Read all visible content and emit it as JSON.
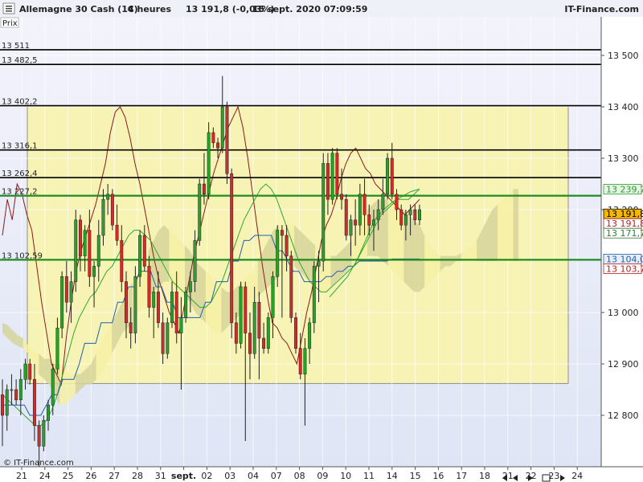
{
  "header": {
    "instrument": "Allemagne 30 Cash (1€)",
    "timeframe": "4 heures",
    "quote": "13 191,8 (-0,03%)",
    "datetime": "15 sept. 2020 07:09:59",
    "brand": "IT-Finance.com"
  },
  "footer": {
    "copyright": "© IT-Finance.com"
  },
  "prix_label": "Prix",
  "chart_data": {
    "type": "line",
    "title": "",
    "ylim": [
      12700,
      13575
    ],
    "y_ticks": [
      {
        "value": 12800,
        "label": "12 800"
      },
      {
        "value": 12900,
        "label": "12 900"
      },
      {
        "value": 13000,
        "label": "13 000"
      },
      {
        "value": 13200,
        "label": "13 200"
      },
      {
        "value": 13300,
        "label": "13 300"
      },
      {
        "value": 13400,
        "label": "13 400"
      },
      {
        "value": 13500,
        "label": "13 500"
      }
    ],
    "x_ticks": [
      "21",
      "24",
      "25",
      "26",
      "27",
      "28",
      "31",
      "sept.",
      "02",
      "03",
      "04",
      "07",
      "08",
      "09",
      "10",
      "11",
      "14",
      "15",
      "16",
      "17",
      "18",
      "21",
      "22",
      "23",
      "24"
    ],
    "levels": [
      {
        "value": 13511,
        "label": "13 511",
        "color": "#000000"
      },
      {
        "value": 13482.5,
        "label": "13 482,5",
        "color": "#000000"
      },
      {
        "value": 13402.2,
        "label": "13 402,2",
        "color": "#000000"
      },
      {
        "value": 13316.1,
        "label": "13 316,1",
        "color": "#000000"
      },
      {
        "value": 13262.4,
        "label": "13 262,4",
        "color": "#000000"
      },
      {
        "value": 13227.2,
        "label": "13 227,2",
        "color": "#1e8c1e"
      },
      {
        "value": 13102.59,
        "label": "13 102,59",
        "color": "#1e8c1e"
      }
    ],
    "value_tags": [
      {
        "value": 13239.7,
        "label": "13 239,7",
        "color": "#2e9a2e",
        "fill": "#e6f5e6"
      },
      {
        "value": 13191.8,
        "label": "13 191,8",
        "color": "#000000",
        "fill": "#f5b800"
      },
      {
        "value": 13191.8,
        "label": "13 191,8",
        "color": "#b22222",
        "fill": "#ffffff"
      },
      {
        "value": 13171.7,
        "label": "13 171,7",
        "color": "#2e7d32",
        "fill": "#ffffff"
      },
      {
        "value": 13104.0,
        "label": "13 104,0",
        "color": "#1f5fb0",
        "fill": "#e6eefa"
      },
      {
        "value": 13103.7,
        "label": "13 103,7",
        "color": "#b22222",
        "fill": "#ffffff"
      }
    ],
    "zone": {
      "top": 13402.2,
      "bottom": 12862
    },
    "candles": [
      [
        12840,
        12870,
        12740,
        12800
      ],
      [
        12800,
        12860,
        12770,
        12850
      ],
      [
        12850,
        12880,
        12820,
        12850
      ],
      [
        12850,
        12870,
        12820,
        12830
      ],
      [
        12830,
        12890,
        12800,
        12870
      ],
      [
        12870,
        12910,
        12850,
        12900
      ],
      [
        12900,
        12910,
        12860,
        12870
      ],
      [
        12870,
        12900,
        12750,
        12780
      ],
      [
        12780,
        12790,
        12700,
        12740
      ],
      [
        12740,
        12800,
        12730,
        12790
      ],
      [
        12790,
        12830,
        12770,
        12820
      ],
      [
        12820,
        12900,
        12800,
        12890
      ],
      [
        12890,
        12990,
        12880,
        12970
      ],
      [
        12970,
        13080,
        12950,
        13070
      ],
      [
        13070,
        13100,
        13000,
        13020
      ],
      [
        13020,
        13080,
        12980,
        13060
      ],
      [
        13060,
        13200,
        13040,
        13180
      ],
      [
        13180,
        13190,
        13080,
        13110
      ],
      [
        13110,
        13170,
        13080,
        13160
      ],
      [
        13160,
        13200,
        13050,
        13070
      ],
      [
        13070,
        13100,
        13010,
        13090
      ],
      [
        13090,
        13180,
        13060,
        13150
      ],
      [
        13150,
        13240,
        13130,
        13220
      ],
      [
        13220,
        13250,
        13190,
        13230
      ],
      [
        13230,
        13240,
        13160,
        13170
      ],
      [
        13170,
        13210,
        13130,
        13140
      ],
      [
        13140,
        13170,
        13040,
        13060
      ],
      [
        13060,
        13080,
        12950,
        12980
      ],
      [
        12980,
        13010,
        12930,
        12960
      ],
      [
        12960,
        13090,
        12940,
        13070
      ],
      [
        13070,
        13160,
        13050,
        13150
      ],
      [
        13150,
        13170,
        13080,
        13090
      ],
      [
        13090,
        13110,
        12990,
        13010
      ],
      [
        13010,
        13050,
        12950,
        13040
      ],
      [
        13040,
        13080,
        12970,
        12980
      ],
      [
        12980,
        13000,
        12900,
        12920
      ],
      [
        12920,
        12990,
        12910,
        12980
      ],
      [
        12980,
        13060,
        12970,
        13040
      ],
      [
        13040,
        13080,
        12940,
        12960
      ],
      [
        12960,
        13030,
        12850,
        12990
      ],
      [
        12990,
        13050,
        12980,
        13040
      ],
      [
        13040,
        13080,
        13000,
        13060
      ],
      [
        13060,
        13160,
        13040,
        13140
      ],
      [
        13140,
        13260,
        13130,
        13250
      ],
      [
        13250,
        13310,
        13210,
        13230
      ],
      [
        13230,
        13370,
        13220,
        13350
      ],
      [
        13350,
        13360,
        13320,
        13330
      ],
      [
        13330,
        13340,
        13300,
        13320
      ],
      [
        13320,
        13460,
        13310,
        13400
      ],
      [
        13400,
        13410,
        13250,
        13270
      ],
      [
        13270,
        13280,
        12950,
        12980
      ],
      [
        12980,
        13000,
        12920,
        12940
      ],
      [
        12940,
        13060,
        12930,
        13050
      ],
      [
        13050,
        13060,
        12750,
        12960
      ],
      [
        12960,
        13000,
        12870,
        12920
      ],
      [
        12920,
        13050,
        12910,
        13020
      ],
      [
        13020,
        13040,
        12870,
        12950
      ],
      [
        12950,
        12980,
        12920,
        12930
      ],
      [
        12930,
        13000,
        12920,
        12990
      ],
      [
        12990,
        13080,
        12950,
        13070
      ],
      [
        13070,
        13170,
        13050,
        13160
      ],
      [
        13160,
        13170,
        12990,
        13150
      ],
      [
        13150,
        13170,
        13080,
        13110
      ],
      [
        13110,
        13120,
        12980,
        12990
      ],
      [
        12990,
        13000,
        12920,
        12930
      ],
      [
        12930,
        12960,
        12870,
        12880
      ],
      [
        12880,
        12950,
        12780,
        12930
      ],
      [
        12930,
        12990,
        12900,
        12980
      ],
      [
        12980,
        13100,
        12960,
        13090
      ],
      [
        13090,
        13120,
        13020,
        13100
      ],
      [
        13100,
        13310,
        13080,
        13290
      ],
      [
        13290,
        13310,
        13190,
        13220
      ],
      [
        13220,
        13320,
        13210,
        13310
      ],
      [
        13310,
        13320,
        13220,
        13230
      ],
      [
        13230,
        13280,
        13200,
        13220
      ],
      [
        13220,
        13230,
        13140,
        13150
      ],
      [
        13150,
        13190,
        13110,
        13180
      ],
      [
        13180,
        13220,
        13130,
        13170
      ],
      [
        13170,
        13250,
        13150,
        13230
      ],
      [
        13230,
        13260,
        13150,
        13190
      ],
      [
        13190,
        13210,
        13150,
        13170
      ],
      [
        13170,
        13200,
        13120,
        13180
      ],
      [
        13180,
        13220,
        13160,
        13200
      ],
      [
        13200,
        13260,
        13190,
        13230
      ],
      [
        13230,
        13310,
        13220,
        13300
      ],
      [
        13300,
        13330,
        13220,
        13230
      ],
      [
        13230,
        13240,
        13180,
        13200
      ],
      [
        13200,
        13210,
        13160,
        13170
      ],
      [
        13170,
        13200,
        13140,
        13190
      ],
      [
        13190,
        13210,
        13150,
        13200
      ],
      [
        13200,
        13210,
        13170,
        13180
      ],
      [
        13180,
        13210,
        13170,
        13200
      ]
    ],
    "overlays": [
      {
        "name": "",
        "color": "#8b1a1a",
        "width": 1,
        "values": [
          13150,
          13220,
          13180,
          13250,
          13230,
          13190,
          13160,
          13090,
          13020,
          12960,
          12900,
          12880,
          12860,
          12950,
          13020,
          13080,
          13120,
          13150,
          13180,
          13210,
          13250,
          13290,
          13350,
          13390,
          13400,
          13380,
          13340,
          13290,
          13250,
          13200,
          13150,
          13100,
          13060,
          13030,
          13000,
          12980,
          12960,
          13010,
          13060,
          13110,
          13150,
          13190,
          13230,
          13270,
          13300,
          13330,
          13360,
          13380,
          13400,
          13360,
          13300,
          13230,
          13160,
          13090,
          13030,
          12980,
          12970,
          12950,
          12940,
          12920,
          12900,
          12950,
          13000,
          13040,
          13090,
          13140,
          13170,
          13190,
          13220,
          13260,
          13290,
          13310,
          13320,
          13300,
          13280,
          13270,
          13250,
          13240,
          13230,
          13220,
          13210,
          13200,
          13190,
          13200,
          13210,
          13220
        ]
      },
      {
        "name": "",
        "color": "#2eaa2e",
        "width": 1,
        "values": [
          12840,
          12830,
          12820,
          12810,
          12800,
          12790,
          12780,
          12780,
          12790,
          12810,
          12840,
          12880,
          12920,
          12960,
          12990,
          13010,
          13030,
          13040,
          13060,
          13080,
          13090,
          13110,
          13130,
          13150,
          13160,
          13160,
          13150,
          13140,
          13120,
          13100,
          13080,
          13060,
          13050,
          13040,
          13030,
          13020,
          13010,
          13010,
          13020,
          13040,
          13060,
          13090,
          13120,
          13150,
          13180,
          13200,
          13220,
          13240,
          13250,
          13240,
          13220,
          13190,
          13160,
          13130,
          13100,
          13080,
          13060,
          13050,
          13040,
          13040,
          13050,
          13060,
          13070,
          13080,
          13090,
          13110,
          13130,
          13150,
          13170,
          13190,
          13200,
          13210,
          13220,
          13220,
          13220,
          13230,
          13240
        ]
      },
      {
        "name": "",
        "color": "#1f5fb0",
        "width": 1,
        "values": [
          12820,
          12820,
          12820,
          12820,
          12820,
          12800,
          12800,
          12800,
          12820,
          12840,
          12840,
          12870,
          12870,
          12870,
          12900,
          12940,
          12940,
          12940,
          12980,
          12980,
          12980,
          13020,
          13020,
          13050,
          13050,
          13080,
          13080,
          13080,
          13050,
          13050,
          13020,
          13020,
          12990,
          12990,
          12990,
          12990,
          12990,
          13020,
          13020,
          13060,
          13060,
          13060,
          13100,
          13100,
          13140,
          13140,
          13150,
          13150,
          13150,
          13150,
          13120,
          13120,
          13100,
          13080,
          13080,
          13060,
          13060,
          13060,
          13060,
          13070,
          13070,
          13080,
          13080,
          13090,
          13090,
          13100,
          13100,
          13100,
          13100,
          13100,
          13100,
          13104,
          13104,
          13104,
          13104,
          13104,
          13104
        ]
      }
    ],
    "cloud": [
      [
        12960,
        12980
      ],
      [
        12950,
        12975
      ],
      [
        12940,
        12965
      ],
      [
        12935,
        12955
      ],
      [
        12930,
        12950
      ],
      [
        12920,
        12935
      ],
      [
        12900,
        12925
      ],
      [
        12880,
        12920
      ],
      [
        12870,
        12910
      ],
      [
        12860,
        12910
      ],
      [
        12840,
        12900
      ],
      [
        12820,
        12900
      ],
      [
        12820,
        12890
      ],
      [
        12830,
        12880
      ],
      [
        12840,
        12880
      ],
      [
        12850,
        12880
      ],
      [
        12860,
        12890
      ],
      [
        12860,
        12900
      ],
      [
        12870,
        12920
      ],
      [
        12880,
        12940
      ],
      [
        12900,
        12960
      ],
      [
        12920,
        12980
      ],
      [
        12940,
        13000
      ],
      [
        12960,
        13020
      ],
      [
        12970,
        13040
      ],
      [
        12980,
        13060
      ],
      [
        13000,
        13080
      ],
      [
        13010,
        13100
      ],
      [
        13030,
        13120
      ],
      [
        13040,
        13140
      ],
      [
        13050,
        13160
      ],
      [
        13060,
        13170
      ],
      [
        13060,
        13160
      ],
      [
        13050,
        13150
      ],
      [
        13040,
        13140
      ],
      [
        13030,
        13130
      ],
      [
        13020,
        13120
      ],
      [
        13000,
        13100
      ],
      [
        12990,
        13090
      ],
      [
        12980,
        13080
      ],
      [
        12970,
        13070
      ],
      [
        12960,
        13060
      ],
      [
        12960,
        13050
      ],
      [
        12970,
        13040
      ],
      [
        12980,
        13040
      ],
      [
        12990,
        13050
      ],
      [
        13000,
        13060
      ],
      [
        13010,
        13070
      ],
      [
        13020,
        13080
      ],
      [
        13030,
        13100
      ],
      [
        13040,
        13120
      ],
      [
        13050,
        13140
      ],
      [
        13060,
        13160
      ],
      [
        13070,
        13170
      ],
      [
        13080,
        13170
      ],
      [
        13090,
        13170
      ],
      [
        13090,
        13170
      ],
      [
        13080,
        13160
      ],
      [
        13070,
        13150
      ],
      [
        13060,
        13140
      ],
      [
        13050,
        13130
      ],
      [
        13040,
        13120
      ],
      [
        13040,
        13110
      ],
      [
        13050,
        13110
      ],
      [
        13060,
        13110
      ],
      [
        13070,
        13120
      ],
      [
        13080,
        13130
      ],
      [
        13090,
        13140
      ],
      [
        13090,
        13160
      ],
      [
        13100,
        13180
      ],
      [
        13110,
        13200
      ],
      [
        13110,
        13210
      ],
      [
        13110,
        13220
      ],
      [
        13100,
        13220
      ],
      [
        13090,
        13220
      ],
      [
        13080,
        13220
      ],
      [
        13070,
        13210
      ],
      [
        13060,
        13200
      ],
      [
        13050,
        13190
      ],
      [
        13040,
        13180
      ],
      [
        13040,
        13170
      ],
      [
        13050,
        13150
      ],
      [
        13060,
        13130
      ],
      [
        13070,
        13120
      ],
      [
        13080,
        13110
      ],
      [
        13090,
        13110
      ],
      [
        13090,
        13110
      ],
      [
        13100,
        13110
      ],
      [
        13100,
        13115
      ],
      [
        13100,
        13120
      ],
      [
        13100,
        13130
      ],
      [
        13100,
        13140
      ],
      [
        13100,
        13160
      ],
      [
        13100,
        13180
      ],
      [
        13100,
        13200
      ],
      [
        13100,
        13210
      ],
      [
        13100,
        13220
      ],
      [
        13100,
        13230
      ],
      [
        13100,
        13240
      ],
      [
        13100,
        13240
      ]
    ],
    "lagging_span": {
      "color": "#2eaa2e",
      "values": [
        13030,
        13050,
        13070,
        13100,
        13140,
        13180,
        13200,
        13215,
        13225,
        13235,
        13240
      ]
    }
  }
}
